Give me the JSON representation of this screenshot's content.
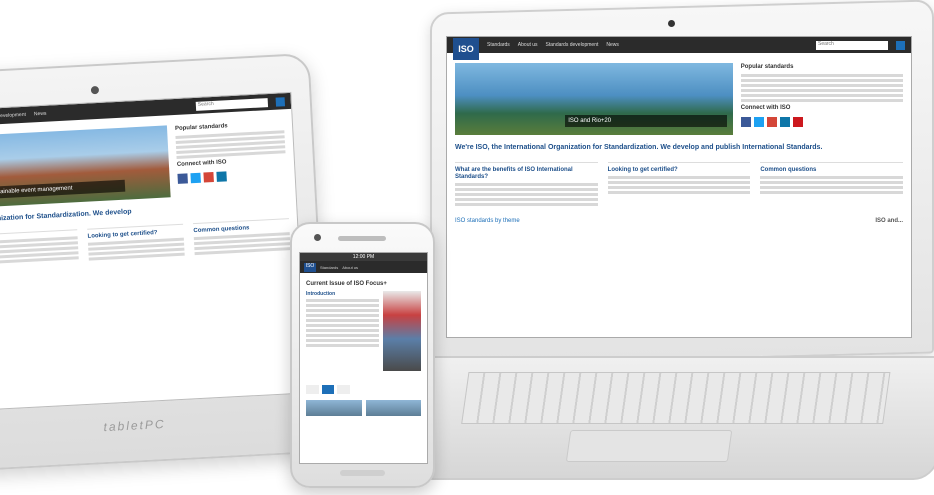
{
  "site": {
    "logo": "ISO",
    "nav": [
      "Standards",
      "About us",
      "Standards development",
      "News"
    ],
    "search_placeholder": "Search",
    "hero_laptop": "ISO and Rio+20",
    "hero_tablet": "Sustainable event management",
    "tagline": "We're ISO, the International Organization for Standardization. We develop and publish International Standards.",
    "tagline_tablet": "Organization for Standardization. We develop",
    "sidebar_title": "Popular standards",
    "follow_title": "Connect with ISO",
    "col1_title": "What are the benefits of ISO International Standards?",
    "col2_title": "Looking to get certified?",
    "col3_title": "Common questions",
    "more_link": "ISO standards by theme",
    "see_all": "ISO and..."
  },
  "phone": {
    "status_time": "12:00 PM",
    "page_title": "Current Issue of ISO Focus+",
    "section_title": "Introduction"
  },
  "tablet_brand": "tabletPC",
  "colors": {
    "brand_blue": "#1f4f8f",
    "link_blue": "#1d6fb8",
    "topbar": "#2b2b2b",
    "social": [
      "#3b5998",
      "#1da1f2",
      "#d44638",
      "#0e76a8",
      "#cc181e"
    ]
  }
}
